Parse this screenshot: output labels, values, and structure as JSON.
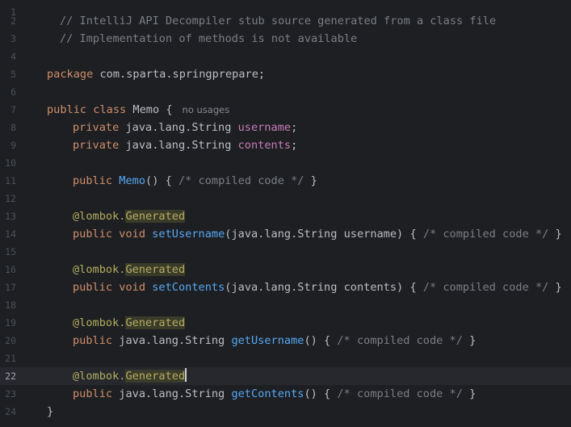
{
  "editor": {
    "line_numbers": [
      "1",
      "2",
      "3",
      "4",
      "5",
      "6",
      "7",
      "8",
      "9",
      "10",
      "11",
      "12",
      "13",
      "14",
      "15",
      "16",
      "17",
      "18",
      "19",
      "20",
      "21",
      "22",
      "23",
      "24"
    ],
    "current_line": "22",
    "comment_line1": "// IntelliJ API Decompiler stub source generated from a class file",
    "comment_line2": "// Implementation of methods is not available",
    "kw_package": "package",
    "package_name": "com.sparta.springprepare;",
    "kw_public": "public",
    "kw_class": "class",
    "class_name": "Memo",
    "brace_open": "{",
    "brace_close": "}",
    "usage_hint": "no usages",
    "kw_private": "private",
    "kw_void": "void",
    "string_type": "java.lang.String",
    "field_username": "username",
    "field_contents": "contents",
    "semicolon": ";",
    "compiled_code": "/* compiled code */",
    "lombok_prefix": "@lombok.",
    "generated": "Generated",
    "set_username": "setUsername",
    "set_contents": "setContents",
    "get_username": "getUsername",
    "get_contents": "getContents",
    "param_username": "(java.lang.String username)",
    "param_contents": "(java.lang.String contents)",
    "empty_parens": "()"
  }
}
